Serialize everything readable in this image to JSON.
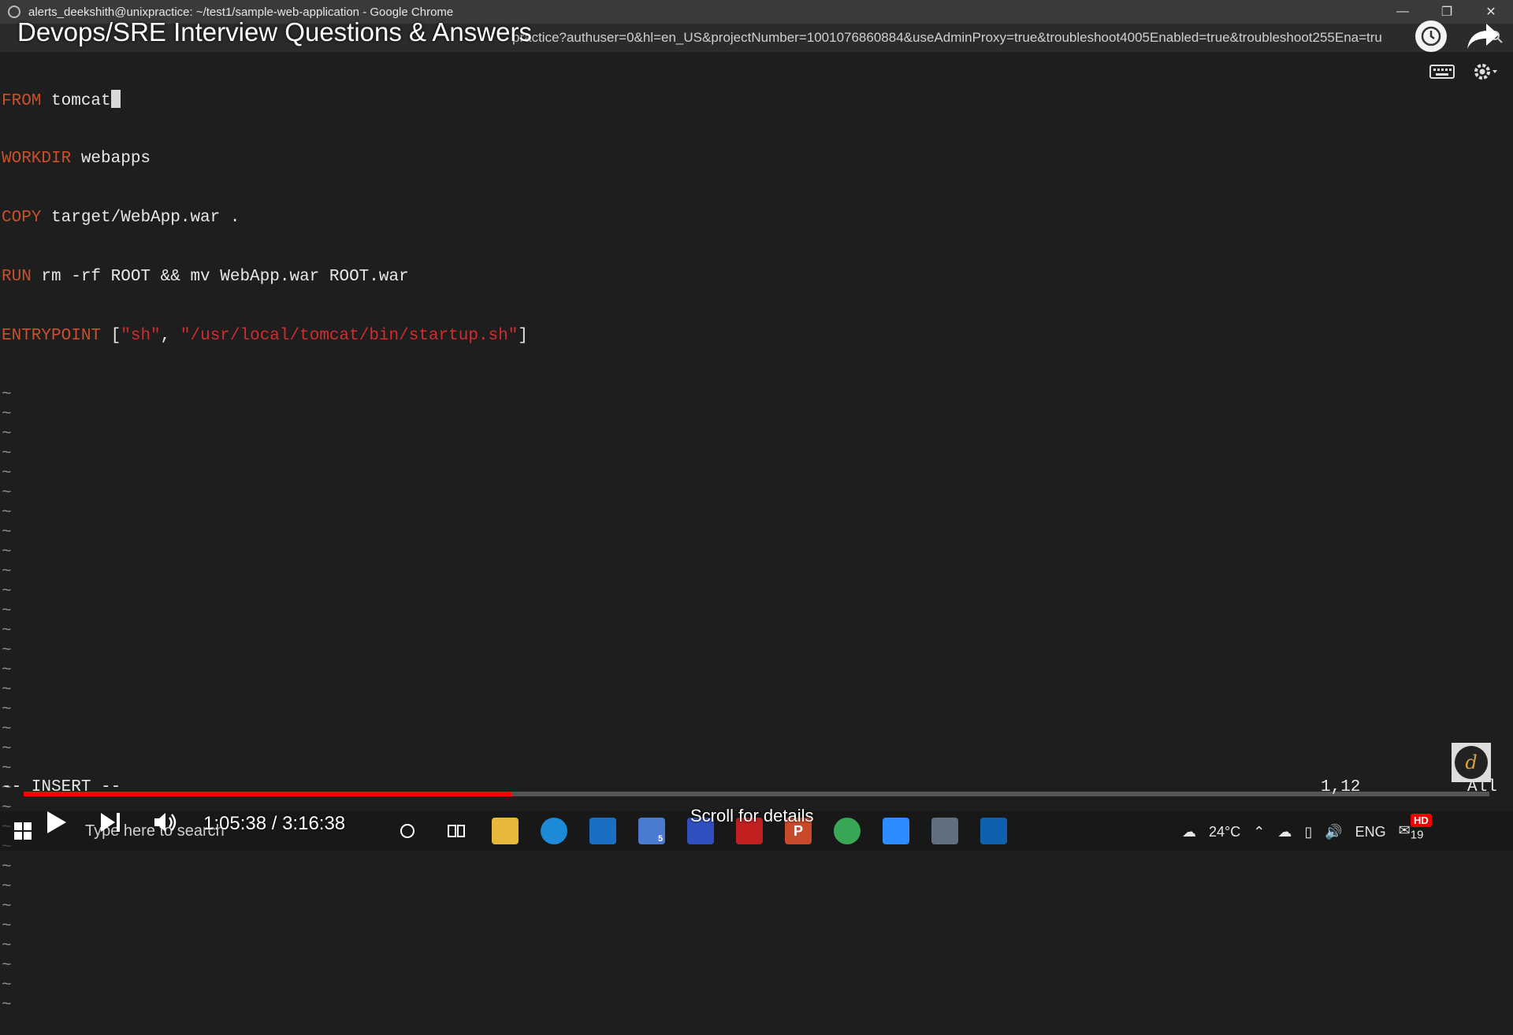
{
  "window": {
    "title": "alerts_deekshith@unixpractice: ~/test1/sample-web-application - Google Chrome",
    "url_visible": "practice?authuser=0&hl=en_US&projectNumber=1001076860884&useAdminProxy=true&troubleshoot4005Enabled=true&troubleshoot255Ena",
    "url_tail": "=tru"
  },
  "video": {
    "title": "Devops/SRE Interview Questions & Answers",
    "time": "1:05:38 / 3:16:38",
    "progress": 0.333,
    "scroll_hint": "Scroll for details",
    "hd": "HD"
  },
  "editor": {
    "lines": [
      {
        "kw": "FROM",
        "rest": " tomcat",
        "cursor": true
      },
      {
        "kw": "WORKDIR",
        "rest": " webapps"
      },
      {
        "kw": "COPY",
        "rest": " target/WebApp.war ."
      },
      {
        "kw": "RUN",
        "rest": " rm -rf ROOT && mv WebApp.war ROOT.war"
      },
      {
        "kw": "ENTRYPOINT",
        "rest_pre": " [",
        "str1": "\"sh\"",
        "sep": ", ",
        "str2": "\"/usr/local/tomcat/bin/startup.sh\"",
        "rest_post": "]"
      }
    ],
    "tilde": "~",
    "tilde_count": 32,
    "mode": "-- INSERT --",
    "position": "1,12",
    "scope": "All"
  },
  "taskbar": {
    "search_placeholder": "Type here to search",
    "temperature": "24°C",
    "language": "ENG",
    "mail_badge": "5",
    "notif_count": "19"
  }
}
